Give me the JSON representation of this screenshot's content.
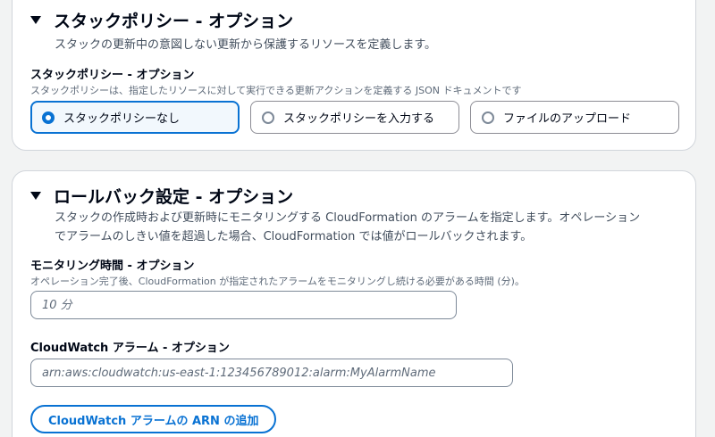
{
  "stack_policy_section": {
    "title": "スタックポリシー - オプション",
    "description": "スタックの更新中の意図しない更新から保護するリソースを定義します。",
    "field_label": "スタックポリシー - オプション",
    "field_description": "スタックポリシーは、指定したリソースに対して実行できる更新アクションを定義する JSON ドキュメントです",
    "options": [
      {
        "label": "スタックポリシーなし",
        "selected": true
      },
      {
        "label": "スタックポリシーを入力する",
        "selected": false
      },
      {
        "label": "ファイルのアップロード",
        "selected": false
      }
    ]
  },
  "rollback_section": {
    "title": "ロールバック設定 - オプション",
    "description_line1": "スタックの作成時および更新時にモニタリングする CloudFormation のアラームを指定します。オペレーション",
    "description_line2": "でアラームのしきい値を超過した場合、CloudFormation では値がロールバックされます。",
    "monitoring_label": "モニタリング時間 - オプション",
    "monitoring_description": "オペレーション完了後、CloudFormation が指定されたアラームをモニタリングし続ける必要がある時間 (分)。",
    "monitoring_placeholder": "10 分",
    "alarm_label": "CloudWatch アラーム - オプション",
    "alarm_placeholder": "arn:aws:cloudwatch:us-east-1:123456789012:alarm:MyAlarmName",
    "add_alarm_button": "CloudWatch アラームの ARN の追加"
  },
  "colors": {
    "accent": "#0972d3",
    "selected_background": "#f2f8fd",
    "panel_border": "#d1d5db",
    "page_background": "#f2f3f3"
  }
}
